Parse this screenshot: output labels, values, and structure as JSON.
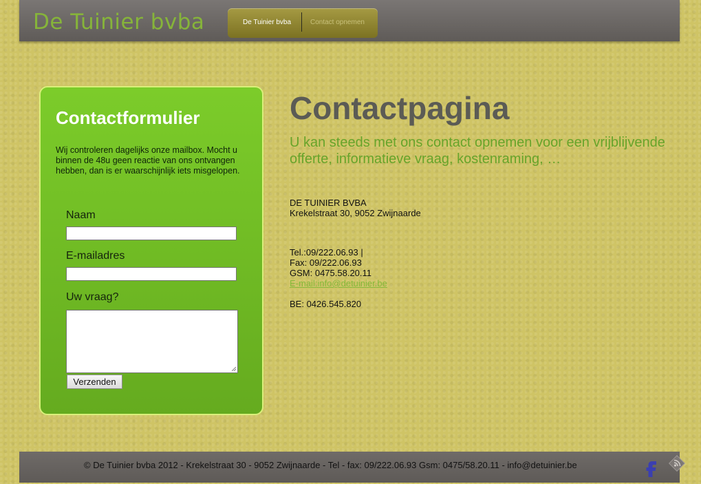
{
  "header": {
    "logo": "De Tuinier bvba",
    "nav": [
      {
        "label": "De Tuinier bvba"
      },
      {
        "label": "Contact opnemen"
      }
    ]
  },
  "form": {
    "title": "Contactformulier",
    "intro": "Wij controleren dagelijks onze mailbox. Mocht u binnen de 48u geen reactie van ons ontvangen hebben, dan is er waarschijnlijk iets misgelopen.",
    "name_label": "Naam",
    "name_value": "",
    "email_label": "E-mailadres",
    "email_value": "",
    "question_label": "Uw vraag?",
    "question_value": "",
    "submit_label": "Verzenden"
  },
  "main": {
    "title": "Contactpagina",
    "subtitle": "U kan steeds met ons contact opnemen voor een vrijblijvende offerte, informatieve vraag, kostenraming, …",
    "company": "DE TUINIER BVBA",
    "address": "Krekelstraat 30, 9052 Zwijnaarde",
    "tel": "Tel.:09/222.06.93 |",
    "fax": "Fax: 09/222.06.93",
    "gsm": "GSM: 0475.58.20.11",
    "email": "E-mail:info@detuinier.be",
    "vat": "BE: 0426.545.820"
  },
  "footer": {
    "text": "© De Tuinier bvba 2012 - Krekelstraat 30 - 9052 Zwijnaarde - Tel - fax:  09/222.06.93 Gsm: 0475/58.20.11 - info@detuinier.be",
    "icons": [
      "facebook-icon",
      "rss-icon"
    ]
  },
  "colors": {
    "background": "#cfc465",
    "accent_green": "#7ccc2a",
    "header_gray": "#6b6764"
  }
}
